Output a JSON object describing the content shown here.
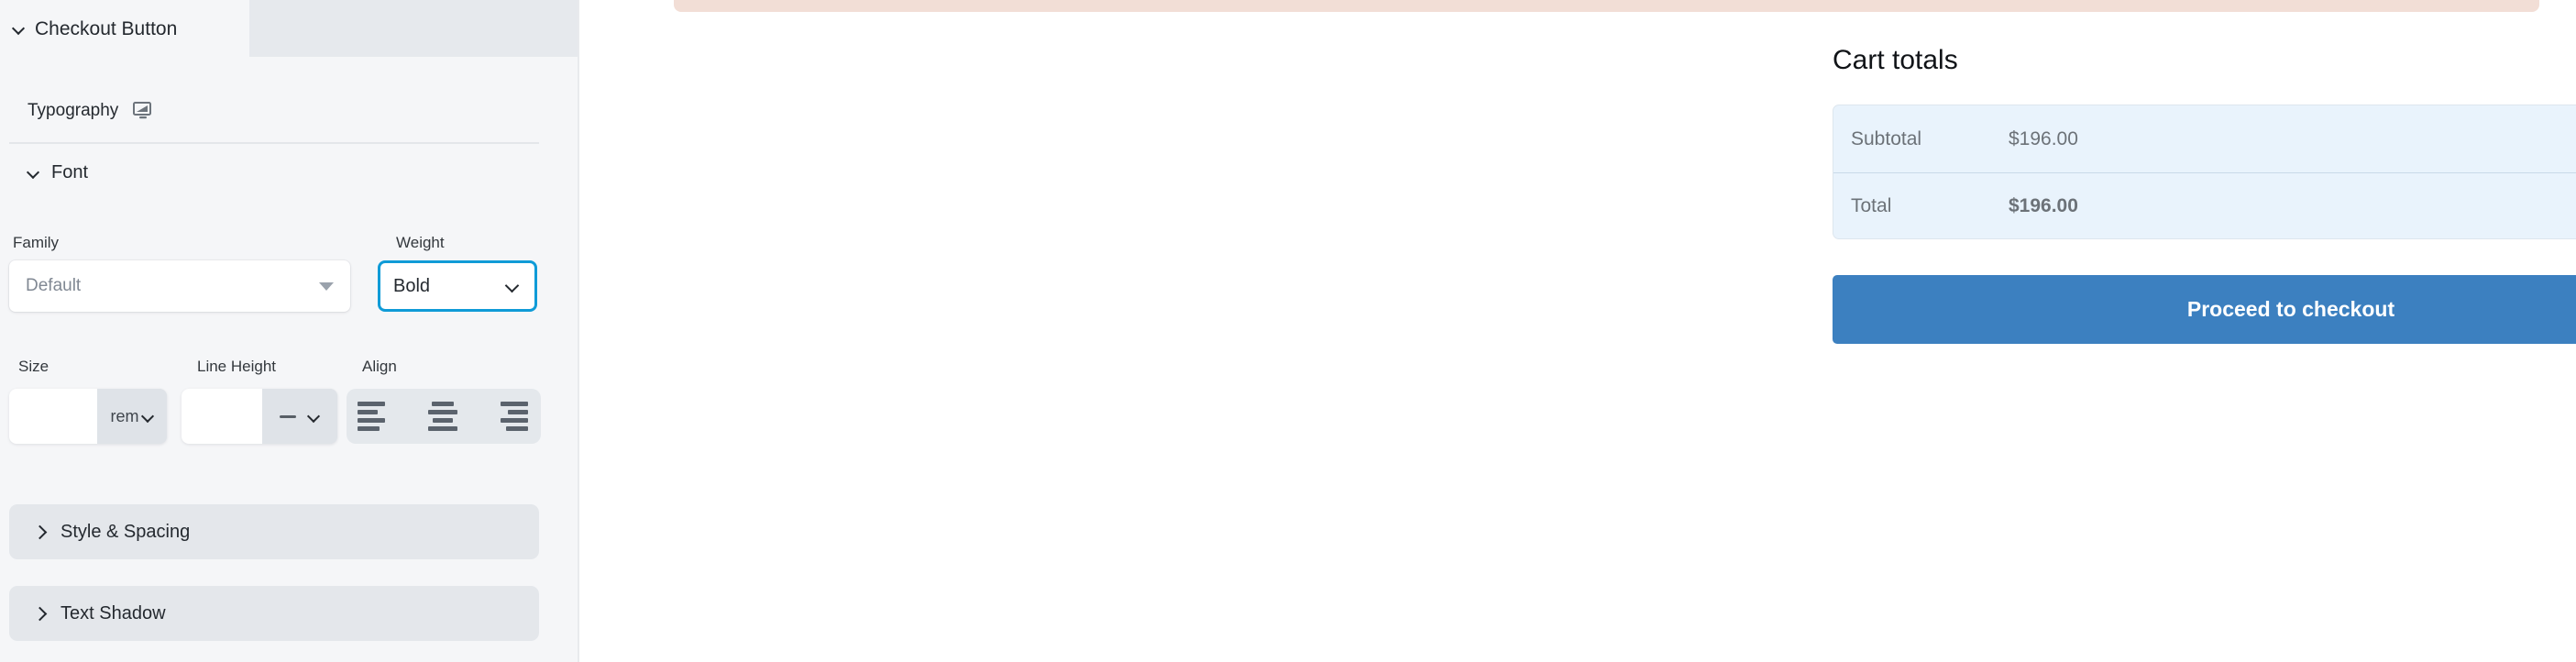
{
  "editor_panel": {
    "active_tab_label": "Checkout Button",
    "typography": {
      "label": "Typography",
      "device_icon": "monitor-icon"
    },
    "font_section": {
      "title": "Font",
      "family": {
        "label": "Family",
        "value": "Default",
        "caret_icon": "caret-down-icon"
      },
      "weight": {
        "label": "Weight",
        "value": "Bold",
        "caret_icon": "chevron-down-icon",
        "focus_color": "#0f9bd7"
      },
      "size": {
        "label": "Size",
        "value": "",
        "unit": "rem",
        "caret_icon": "chevron-down-icon"
      },
      "line_height": {
        "label": "Line Height",
        "value": "",
        "unit": "—",
        "caret_icon": "chevron-down-icon"
      },
      "align": {
        "label": "Align",
        "options": [
          "align-left",
          "align-center",
          "align-right"
        ]
      }
    },
    "accordions": [
      {
        "label": "Style & Spacing",
        "icon": "chevron-right-icon"
      },
      {
        "label": "Text Shadow",
        "icon": "chevron-right-icon"
      }
    ]
  },
  "preview": {
    "cart": {
      "title": "Cart totals",
      "rows": [
        {
          "label": "Subtotal",
          "value": "$196.00"
        },
        {
          "label": "Total",
          "value": "$196.00"
        }
      ],
      "checkout_label": "Proceed to checkout",
      "checkout_color": "#3c80c0",
      "box_color": "#e9f3fc",
      "notice_color": "#f2ded6"
    }
  }
}
